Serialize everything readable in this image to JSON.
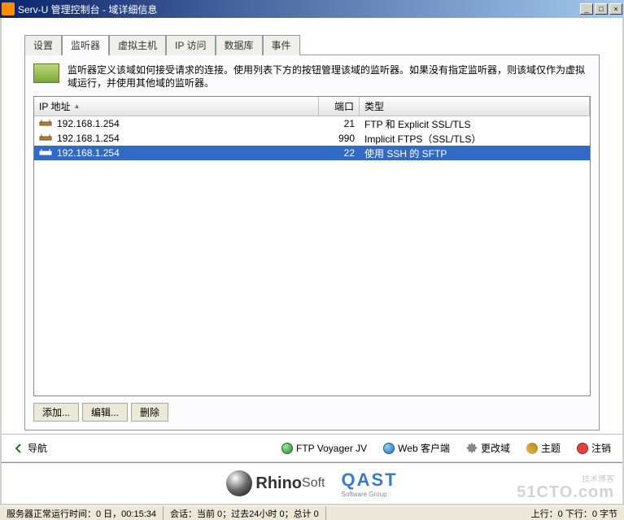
{
  "window": {
    "title": "Serv-U 管理控制台 - 域详细信息"
  },
  "tabs": {
    "settings": "设置",
    "listeners": "监听器",
    "vhosts": "虚拟主机",
    "ipaccess": "IP 访问",
    "database": "数据库",
    "events": "事件"
  },
  "info": "监听器定义该域如何接受请求的连接。使用列表下方的按钮管理该域的监听器。如果没有指定监听器，则该域仅作为虚拟域运行，并使用其他域的监听器。",
  "columns": {
    "ip": "IP 地址",
    "port": "端口",
    "type": "类型"
  },
  "rows": [
    {
      "ip": "192.168.1.254",
      "port": "21",
      "type": "FTP 和 Explicit SSL/TLS",
      "selected": false
    },
    {
      "ip": "192.168.1.254",
      "port": "990",
      "type": "Implicit FTPS（SSL/TLS）",
      "selected": false
    },
    {
      "ip": "192.168.1.254",
      "port": "22",
      "type": "使用 SSH 的 SFTP",
      "selected": true
    }
  ],
  "buttons": {
    "add": "添加...",
    "edit": "编辑...",
    "delete": "删除"
  },
  "bottombar": {
    "nav": "导航",
    "ftpvoyager": "FTP Voyager JV",
    "webclient": "Web 客户端",
    "changedomain": "更改域",
    "theme": "主题",
    "logout": "注销"
  },
  "logos": {
    "rhino": "Rhino",
    "soft": "Soft",
    "qast": "QAST",
    "qast_sub": "Software Group",
    "watermark": "51CTO.com",
    "watermark2": "技术博客"
  },
  "status": {
    "uptime": "服务器正常运行时间：0 日，00:15:34",
    "sessions": "会话：当前 0；过去24小时 0；总计 0",
    "traffic": "上行：0 下行：0 字节"
  }
}
